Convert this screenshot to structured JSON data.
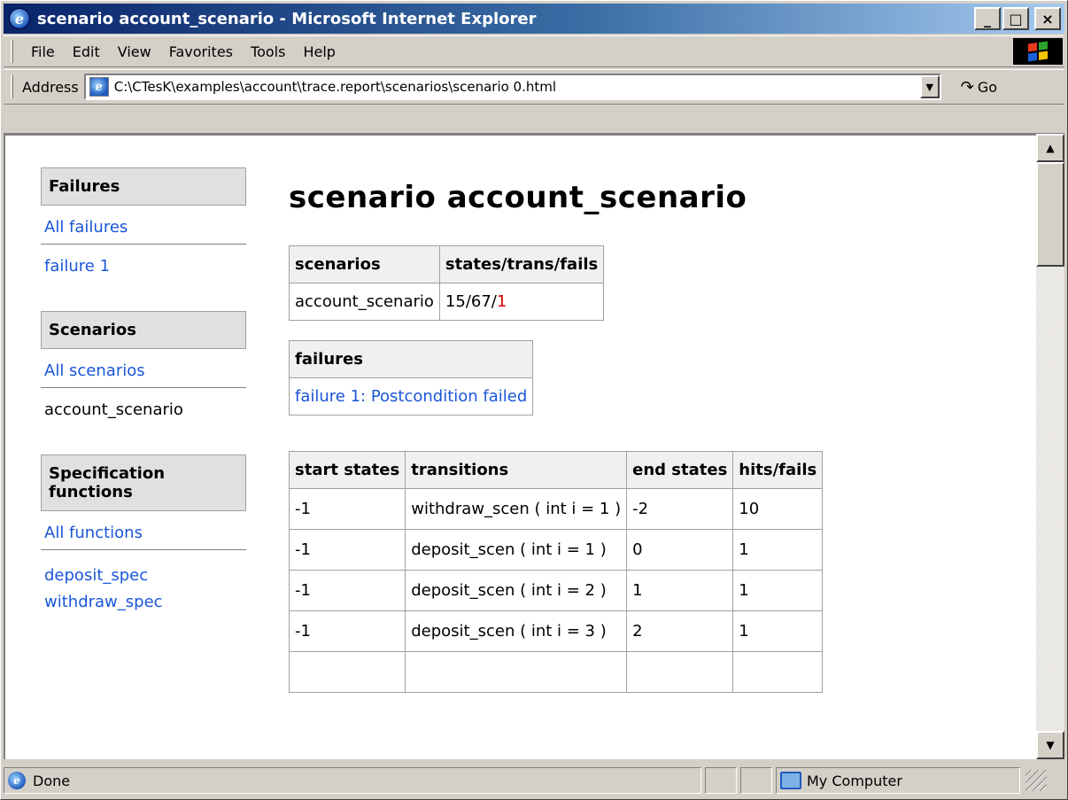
{
  "window": {
    "title": "scenario account_scenario - Microsoft Internet Explorer",
    "min": "_",
    "max": "□",
    "close": "×"
  },
  "menu": [
    "File",
    "Edit",
    "View",
    "Favorites",
    "Tools",
    "Help"
  ],
  "address": {
    "label": "Address",
    "url": "C:\\CTesK\\examples\\account\\trace.report\\scenarios\\scenario 0.html",
    "go": "Go"
  },
  "sidebar": {
    "failures_head": "Failures",
    "all_failures": "All failures",
    "failure1": "failure 1",
    "scenarios_head": "Scenarios",
    "all_scenarios": "All scenarios",
    "current_scenario": "account_scenario",
    "spec_head": "Specification functions",
    "all_functions": "All functions",
    "functions": [
      "deposit_spec",
      "withdraw_spec"
    ]
  },
  "main": {
    "title": "scenario account_scenario",
    "summary": {
      "headers": [
        "scenarios",
        "states/trans/fails"
      ],
      "row": {
        "scenario": "account_scenario",
        "counts": "15/67/",
        "fails": "1"
      }
    },
    "failures": {
      "header": "failures",
      "item": "failure 1: Postcondition failed"
    },
    "transitions": {
      "headers": [
        "start states",
        "transitions",
        "end states",
        "hits/fails"
      ],
      "rows": [
        [
          "-1",
          "withdraw_scen ( int i = 1 )",
          "-2",
          "10"
        ],
        [
          "-1",
          "deposit_scen ( int i = 1 )",
          "0",
          "1"
        ],
        [
          "-1",
          "deposit_scen ( int i = 2 )",
          "1",
          "1"
        ],
        [
          "-1",
          "deposit_scen ( int i = 3 )",
          "2",
          "1"
        ]
      ]
    }
  },
  "status": {
    "text": "Done",
    "zone": "My Computer"
  }
}
